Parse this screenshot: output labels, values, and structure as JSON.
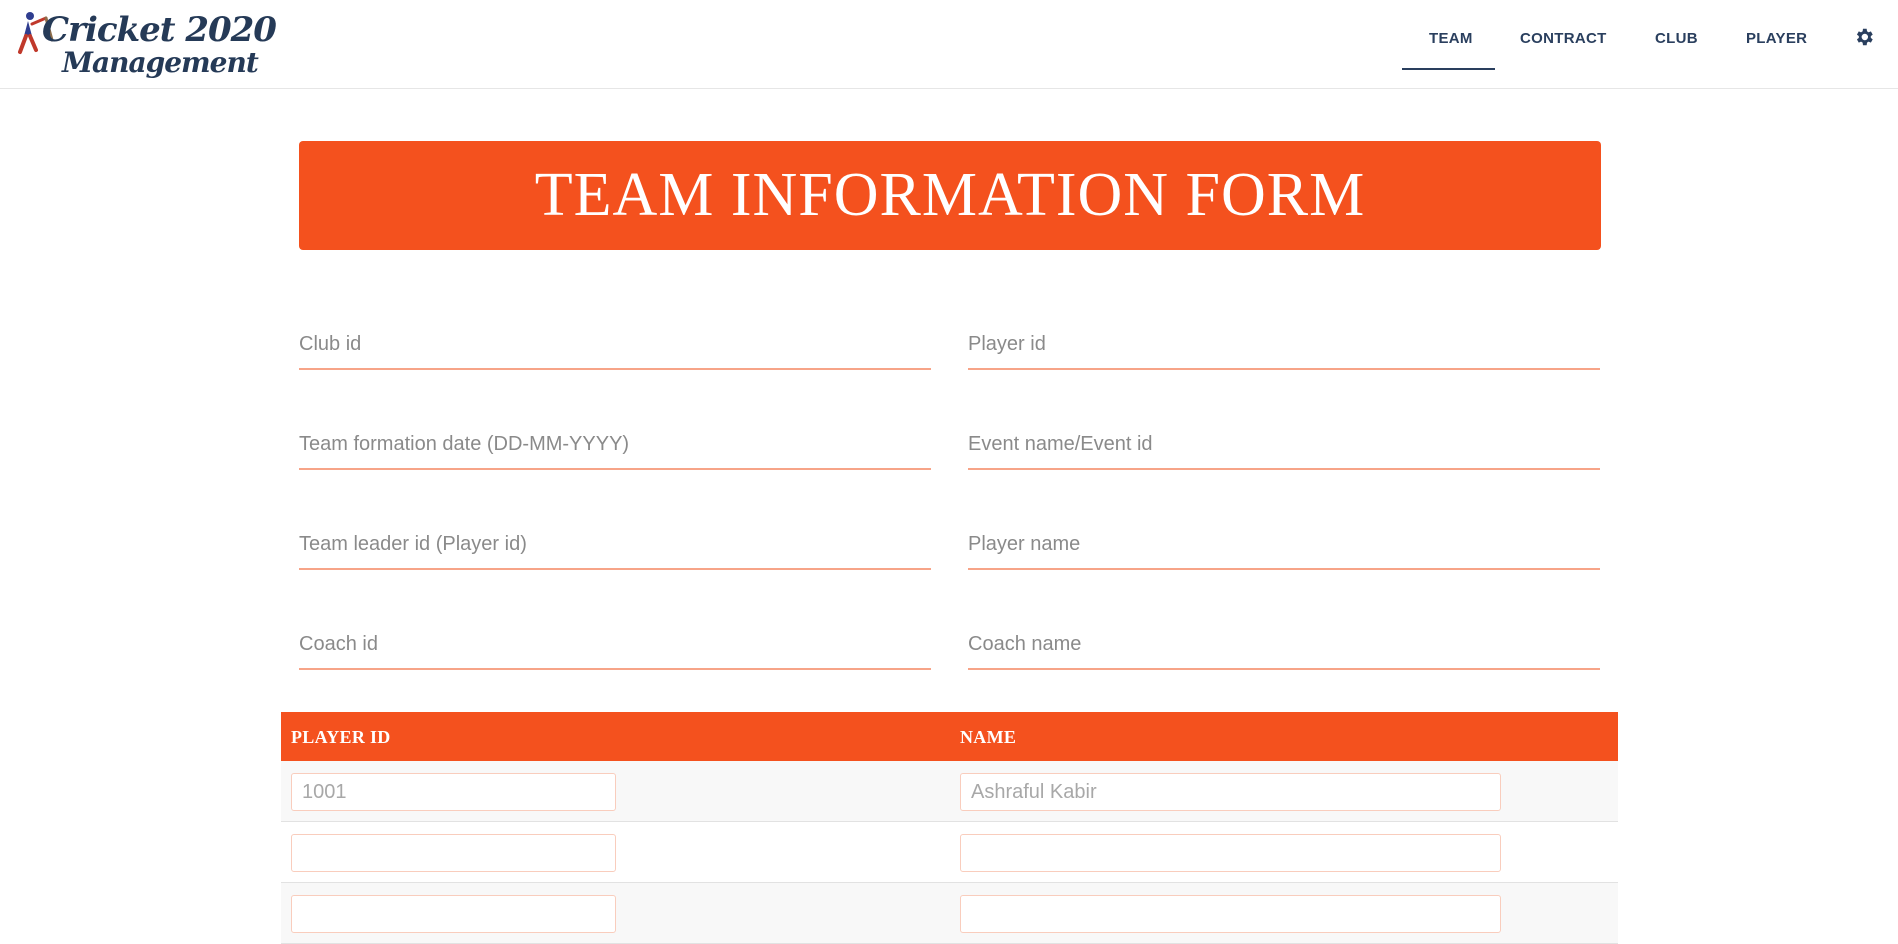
{
  "brand": {
    "line1": "Cricket 2020",
    "line2": "Management"
  },
  "nav": {
    "items": [
      {
        "label": "TEAM",
        "active": true
      },
      {
        "label": "CONTRACT",
        "active": false
      },
      {
        "label": "CLUB",
        "active": false
      },
      {
        "label": "PLAYER",
        "active": false
      }
    ],
    "settings_icon": "gear-icon"
  },
  "banner": {
    "title": "TEAM INFORMATION FORM"
  },
  "form": {
    "fields": [
      {
        "placeholder": "Club id",
        "value": ""
      },
      {
        "placeholder": "Player id",
        "value": ""
      },
      {
        "placeholder": "Team formation date (DD-MM-YYYY)",
        "value": ""
      },
      {
        "placeholder": "Event name/Event id",
        "value": ""
      },
      {
        "placeholder": "Team leader id (Player id)",
        "value": ""
      },
      {
        "placeholder": "Player name",
        "value": ""
      },
      {
        "placeholder": "Coach id",
        "value": ""
      },
      {
        "placeholder": "Coach name",
        "value": ""
      }
    ]
  },
  "table": {
    "headers": [
      "PLAYER ID",
      "NAME"
    ],
    "rows": [
      {
        "player_id_placeholder": "1001",
        "name_placeholder": "Ashraful Kabir"
      },
      {
        "player_id_placeholder": "",
        "name_placeholder": ""
      },
      {
        "player_id_placeholder": "",
        "name_placeholder": ""
      }
    ]
  },
  "colors": {
    "accent": "#f4511e",
    "nav_text": "#2a3f5e",
    "field_underline": "#f7a488"
  }
}
